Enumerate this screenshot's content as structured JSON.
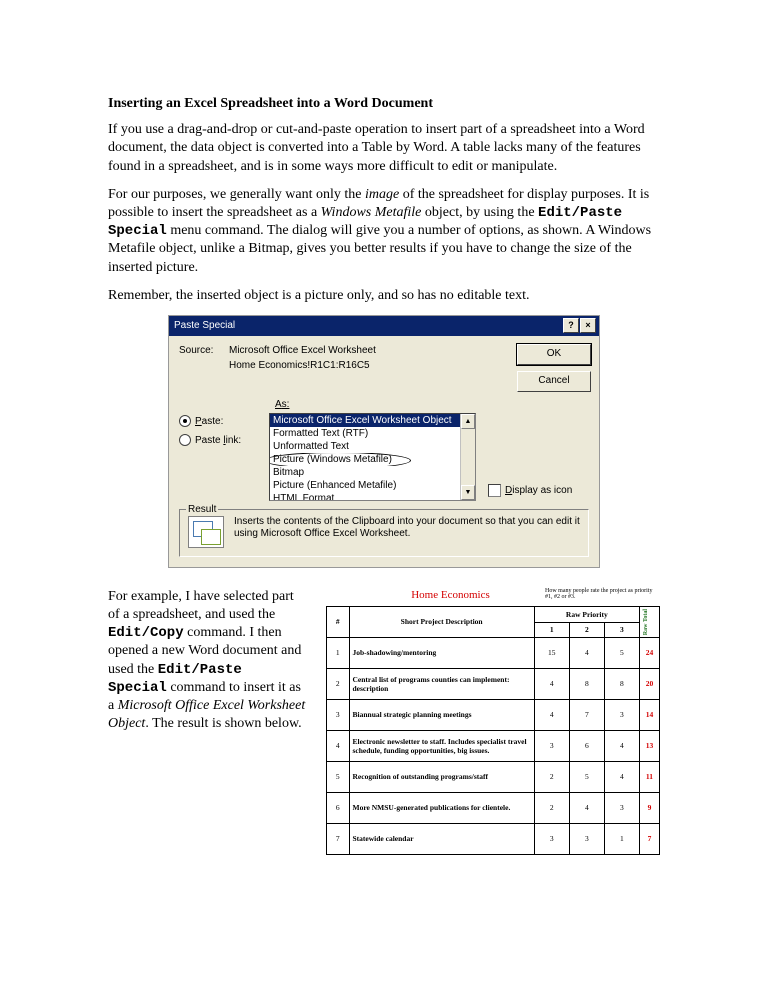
{
  "title": "Inserting an Excel Spreadsheet into a Word Document",
  "para1": "If you use a drag-and-drop or cut-and-paste operation to insert part of a spreadsheet into a Word document, the data object is converted into a Table by Word.  A table lacks many of the features found in a spreadsheet, and is in some ways more difficult to edit or manipulate.",
  "para2_a": "For our purposes, we generally want only the ",
  "para2_i1": "image",
  "para2_b": " of the spreadsheet for display purposes.  It is possible to insert the spreadsheet as a ",
  "para2_i2": "Windows Metafile",
  "para2_c": " object, by using the ",
  "para2_m1": "Edit/Paste Special",
  "para2_d": " menu command.  The dialog will give you a number of options, as shown.  A Windows Metafile object, unlike a Bitmap, gives you better results if you have to change the size of the inserted picture.",
  "para3": "Remember, the inserted object is a picture only, and so has no editable text.",
  "dialog": {
    "title": "Paste Special",
    "help_btn": "?",
    "close_btn": "×",
    "source_label": "Source:",
    "source_line1": "Microsoft Office Excel Worksheet",
    "source_line2": "Home Economics!R1C1:R16C5",
    "ok": "OK",
    "cancel": "Cancel",
    "as_label": "As:",
    "radio_paste": "Paste:",
    "radio_pastelink": "Paste link:",
    "list": [
      "Microsoft Office Excel Worksheet Object",
      "Formatted Text (RTF)",
      "Unformatted Text",
      "Picture (Windows Metafile)",
      "Bitmap",
      "Picture (Enhanced Metafile)",
      "HTML Format"
    ],
    "display_as_icon": "Display as icon",
    "result_label": "Result",
    "result_text": "Inserts the contents of the Clipboard into your document so that you can edit it using Microsoft Office Excel Worksheet."
  },
  "para4_a": "For example, I have selected part of a spreadsheet, and used the ",
  "para4_m1": "Edit/Copy",
  "para4_b": " command.  I then opened a new Word document and used the ",
  "para4_m2": "Edit/Paste Special",
  "para4_c": " command to insert it as a ",
  "para4_i1": "Microsoft Office Excel Worksheet Object",
  "para4_d": ".  The result is shown below.",
  "sheet": {
    "title": "Home Economics",
    "note": "How many people rate the project as priority #1, #2 or #3.",
    "raw_priority": "Raw Priority",
    "raw_total": "Raw Total",
    "h_num": "#",
    "h_desc": "Short Project Description",
    "h1": "1",
    "h2": "2",
    "h3": "3"
  },
  "chart_data": {
    "type": "table",
    "columns": [
      "#",
      "Short Project Description",
      "1",
      "2",
      "3",
      "Raw Total"
    ],
    "rows": [
      {
        "num": "1",
        "desc": "Job-shadowing/mentoring",
        "p1": 15,
        "p2": 4,
        "p3": 5,
        "total": 24
      },
      {
        "num": "2",
        "desc": "Central list of programs counties can implement: description",
        "p1": 4,
        "p2": 8,
        "p3": 8,
        "total": 20
      },
      {
        "num": "3",
        "desc": "Biannual strategic planning meetings",
        "p1": 4,
        "p2": 7,
        "p3": 3,
        "total": 14
      },
      {
        "num": "4",
        "desc": "Electronic newsletter to staff. Includes specialist travel schedule, funding opportunities, big issues.",
        "p1": 3,
        "p2": 6,
        "p3": 4,
        "total": 13
      },
      {
        "num": "5",
        "desc": "Recognition of outstanding programs/staff",
        "p1": 2,
        "p2": 5,
        "p3": 4,
        "total": 11
      },
      {
        "num": "6",
        "desc": "More NMSU-generated publications for clientele.",
        "p1": 2,
        "p2": 4,
        "p3": 3,
        "total": 9
      },
      {
        "num": "7",
        "desc": "Statewide calendar",
        "p1": 3,
        "p2": 3,
        "p3": 1,
        "total": 7
      }
    ]
  }
}
